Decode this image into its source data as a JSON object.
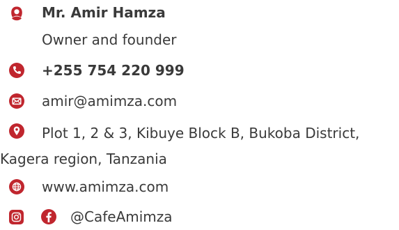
{
  "contact": {
    "colors": {
      "icon": "#c0262e",
      "text": "#3a3a3a"
    },
    "person": {
      "icon": "person-icon",
      "name": "Mr. Amir Hamza",
      "role": "Owner and founder"
    },
    "phone": {
      "icon": "phone-icon",
      "number": "+255 754 220 999"
    },
    "email": {
      "icon": "envelope-icon",
      "address": "amir@amimza.com"
    },
    "address": {
      "icon": "location-pin-icon",
      "text": "Plot 1, 2 & 3, Kibuye Block B, Bukoba District, Kagera region, Tanzania"
    },
    "website": {
      "icon": "globe-icon",
      "url": "www.amimza.com"
    },
    "social": {
      "icons": [
        "instagram-icon",
        "facebook-icon"
      ],
      "handle": "@CafeAmimza"
    }
  }
}
